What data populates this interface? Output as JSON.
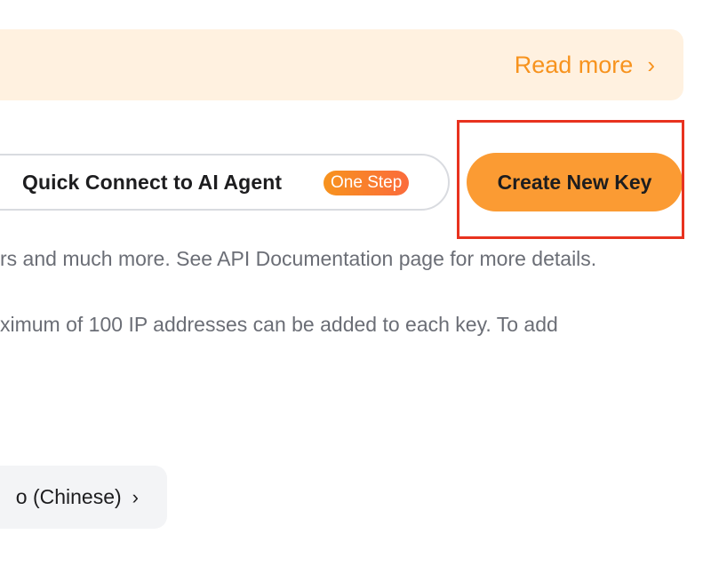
{
  "banner": {
    "read_more_label": "Read more",
    "read_more_icon": "chevron-right-icon"
  },
  "actions": {
    "quick_connect_label": "Quick Connect to AI Agent",
    "one_step_badge": "One Step",
    "create_key_label": "Create New Key"
  },
  "description": {
    "line1": "rs and much more. See API Documentation page for more details.",
    "line2": "ximum of 100 IP addresses can be added to each key. To add"
  },
  "guide": {
    "label": "o (Chinese)",
    "icon": "chevron-right-icon"
  },
  "colors": {
    "accent": "#f7931e",
    "banner_bg": "#fff1e0",
    "highlight": "#e8321f"
  }
}
